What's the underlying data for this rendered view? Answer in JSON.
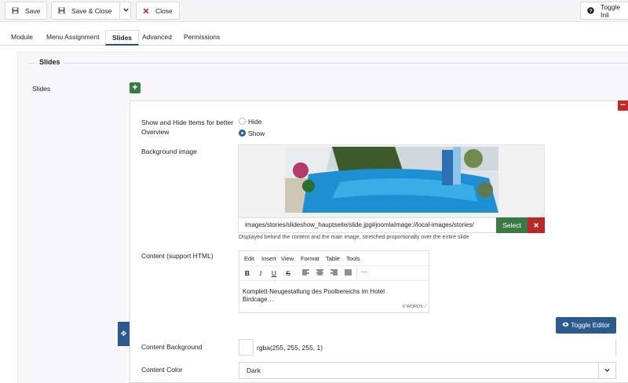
{
  "toolbar": {
    "save_label": "Save",
    "save_close_label": "Save & Close",
    "close_label": "Close",
    "toggle_label": "Toggle Inli",
    "colors": {
      "save_icon": "#3c7a45",
      "close_icon": "#c22b2b"
    }
  },
  "tabs": [
    {
      "label": "Module"
    },
    {
      "label": "Menu Assignment"
    },
    {
      "label": "Slides"
    },
    {
      "label": "Advanced"
    },
    {
      "label": "Permissions"
    }
  ],
  "active_tab": "Slides",
  "section": {
    "legend": "Slides",
    "field_label": "Slides"
  },
  "slide": {
    "show_hide_label": "Show and Hide Items for better Overview",
    "options": [
      {
        "label": "Hide",
        "checked": false
      },
      {
        "label": "Show",
        "checked": true
      }
    ],
    "bg_image_label": "Background image",
    "image_path": "images/stories/slideshow_hauptseite/slide.jpg#joomlaImage://local-images/stories/",
    "select_label": "Select",
    "clear_icon": "times-icon",
    "bg_help": "Displayed behind the content and the main image, stretched proportionally over the entire slide",
    "content_label": "Content (support HTML)",
    "editor_menu": [
      "Edit",
      "Insert",
      "View",
      "Format",
      "Table",
      "Tools"
    ],
    "editor_text": "Komplett-Neugestaltung des Poolbereichs  im Hotel Birdcage…",
    "word_count": "6 WORDS",
    "toggle_editor_label": "Toggle Editor",
    "content_bg_label": "Content Background",
    "content_bg_value": "rgba(255, 255, 255, 1)",
    "content_color_label": "Content Color",
    "content_color_value": "Dark"
  }
}
